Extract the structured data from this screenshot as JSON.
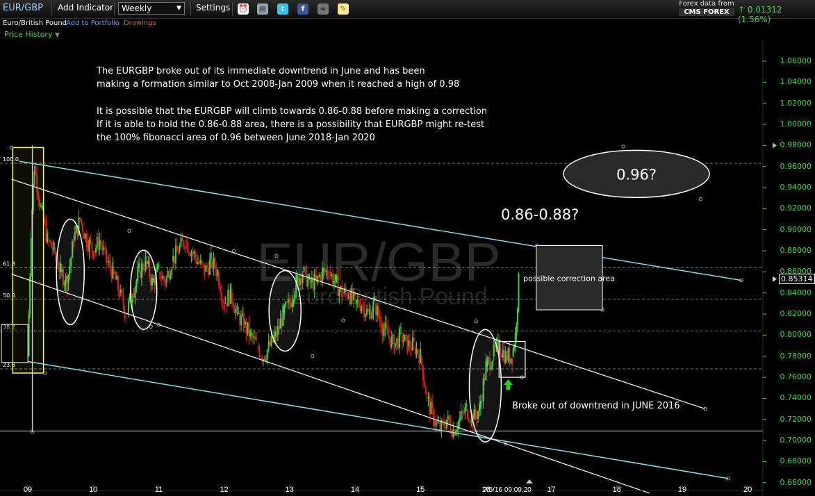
{
  "toolbar": {
    "symbol": "EUR/GBP",
    "add_indicator": "Add Indicator",
    "period": "Weekly",
    "settings": "Settings",
    "source_line1": "Forex data from",
    "source_line2": "CMS FOREX",
    "change": "0.01312 (1.56%)",
    "icons": [
      "alarm-clock-icon",
      "book-icon",
      "twitter-icon",
      "facebook-icon",
      "binoculars-icon",
      "note-icon"
    ]
  },
  "subheader": {
    "name": "Euro/British Pound",
    "add_portfolio": "Add to Portfolio",
    "drawings": "Drawings",
    "price_history": "Price History"
  },
  "colors": {
    "green": "#3fdc3f",
    "cyan": "#7fe0ef",
    "yellow": "#ffff3c",
    "background": "#000000"
  },
  "chart_data": {
    "type": "candlestick",
    "symbol": "EUR/GBP",
    "watermark_title": "EUR/GBP",
    "watermark_subtitle": "Euro/British Pound",
    "x_ticks": [
      "09",
      "10",
      "11",
      "12",
      "13",
      "14",
      "15",
      "16",
      "17",
      "18",
      "19",
      "20"
    ],
    "x_cursor_label": "7/5/16 09:09:20",
    "y_ticks": [
      "1.06000",
      "1.04000",
      "1.02000",
      "1.00000",
      "0.98000",
      "0.96000",
      "0.94000",
      "0.92000",
      "0.90000",
      "0.88000",
      "0.86000",
      "0.84000",
      "0.82000",
      "0.80000",
      "0.78000",
      "0.76000",
      "0.74000",
      "0.72000",
      "0.70000",
      "0.68000",
      "0.66000"
    ],
    "ylim": [
      0.66,
      1.06
    ],
    "current_price": "0.85314",
    "fib_levels": [
      {
        "label": "100.0",
        "value": 0.963
      },
      {
        "label": "61.8",
        "value": 0.864
      },
      {
        "label": "50.0",
        "value": 0.834
      },
      {
        "label": "38.2",
        "value": 0.804
      },
      {
        "label": "23.6",
        "value": 0.768
      }
    ],
    "fib_extra_level": 0.709,
    "price_path": [
      [
        2009.0,
        0.78
      ],
      [
        2009.05,
        0.9
      ],
      [
        2009.1,
        0.96
      ],
      [
        2009.2,
        0.92
      ],
      [
        2009.3,
        0.89
      ],
      [
        2009.4,
        0.88
      ],
      [
        2009.5,
        0.86
      ],
      [
        2009.6,
        0.85
      ],
      [
        2009.7,
        0.89
      ],
      [
        2009.8,
        0.91
      ],
      [
        2009.9,
        0.89
      ],
      [
        2010.0,
        0.88
      ],
      [
        2010.1,
        0.89
      ],
      [
        2010.2,
        0.87
      ],
      [
        2010.3,
        0.86
      ],
      [
        2010.4,
        0.84
      ],
      [
        2010.5,
        0.82
      ],
      [
        2010.6,
        0.84
      ],
      [
        2010.7,
        0.86
      ],
      [
        2010.8,
        0.87
      ],
      [
        2010.9,
        0.85
      ],
      [
        2011.0,
        0.86
      ],
      [
        2011.1,
        0.85
      ],
      [
        2011.2,
        0.87
      ],
      [
        2011.3,
        0.88
      ],
      [
        2011.4,
        0.89
      ],
      [
        2011.5,
        0.88
      ],
      [
        2011.6,
        0.87
      ],
      [
        2011.7,
        0.86
      ],
      [
        2011.8,
        0.87
      ],
      [
        2011.9,
        0.86
      ],
      [
        2012.0,
        0.83
      ],
      [
        2012.1,
        0.84
      ],
      [
        2012.2,
        0.82
      ],
      [
        2012.3,
        0.81
      ],
      [
        2012.4,
        0.8
      ],
      [
        2012.5,
        0.79
      ],
      [
        2012.6,
        0.78
      ],
      [
        2012.7,
        0.79
      ],
      [
        2012.8,
        0.8
      ],
      [
        2012.9,
        0.82
      ],
      [
        2013.0,
        0.83
      ],
      [
        2013.1,
        0.85
      ],
      [
        2013.2,
        0.86
      ],
      [
        2013.3,
        0.85
      ],
      [
        2013.4,
        0.85
      ],
      [
        2013.5,
        0.86
      ],
      [
        2013.6,
        0.86
      ],
      [
        2013.7,
        0.85
      ],
      [
        2013.8,
        0.84
      ],
      [
        2013.9,
        0.84
      ],
      [
        2014.0,
        0.83
      ],
      [
        2014.1,
        0.83
      ],
      [
        2014.2,
        0.82
      ],
      [
        2014.3,
        0.83
      ],
      [
        2014.4,
        0.81
      ],
      [
        2014.5,
        0.8
      ],
      [
        2014.6,
        0.79
      ],
      [
        2014.7,
        0.8
      ],
      [
        2014.8,
        0.79
      ],
      [
        2014.9,
        0.79
      ],
      [
        2015.0,
        0.78
      ],
      [
        2015.1,
        0.74
      ],
      [
        2015.2,
        0.72
      ],
      [
        2015.3,
        0.71
      ],
      [
        2015.4,
        0.72
      ],
      [
        2015.5,
        0.71
      ],
      [
        2015.6,
        0.72
      ],
      [
        2015.7,
        0.73
      ],
      [
        2015.8,
        0.72
      ],
      [
        2015.9,
        0.73
      ],
      [
        2016.0,
        0.77
      ],
      [
        2016.1,
        0.78
      ],
      [
        2016.2,
        0.79
      ],
      [
        2016.3,
        0.78
      ],
      [
        2016.4,
        0.78
      ],
      [
        2016.45,
        0.8
      ],
      [
        2016.5,
        0.85
      ]
    ],
    "annotations": {
      "para1": [
        "The EURGBP broke out of its immediate downtrend in June and has been",
        "making a formation similar to Oct 2008-Jan 2009 when it reached a high of 0.98"
      ],
      "para2": [
        "It is possible that the EURGBP will climb towards 0.86-0.88 before making a correction",
        "If it is able to hold the 0.86-0.88 area, there is a possibility that EURGBP might re-test",
        "the 100% fibonacci area of 0.96 between June 2018-Jan 2020"
      ],
      "target_ellipse": "0.96?",
      "target_range": "0.86-0.88?",
      "correction_box": "possible correction area",
      "breakout": "Broke out of downtrend in JUNE 2016"
    }
  }
}
